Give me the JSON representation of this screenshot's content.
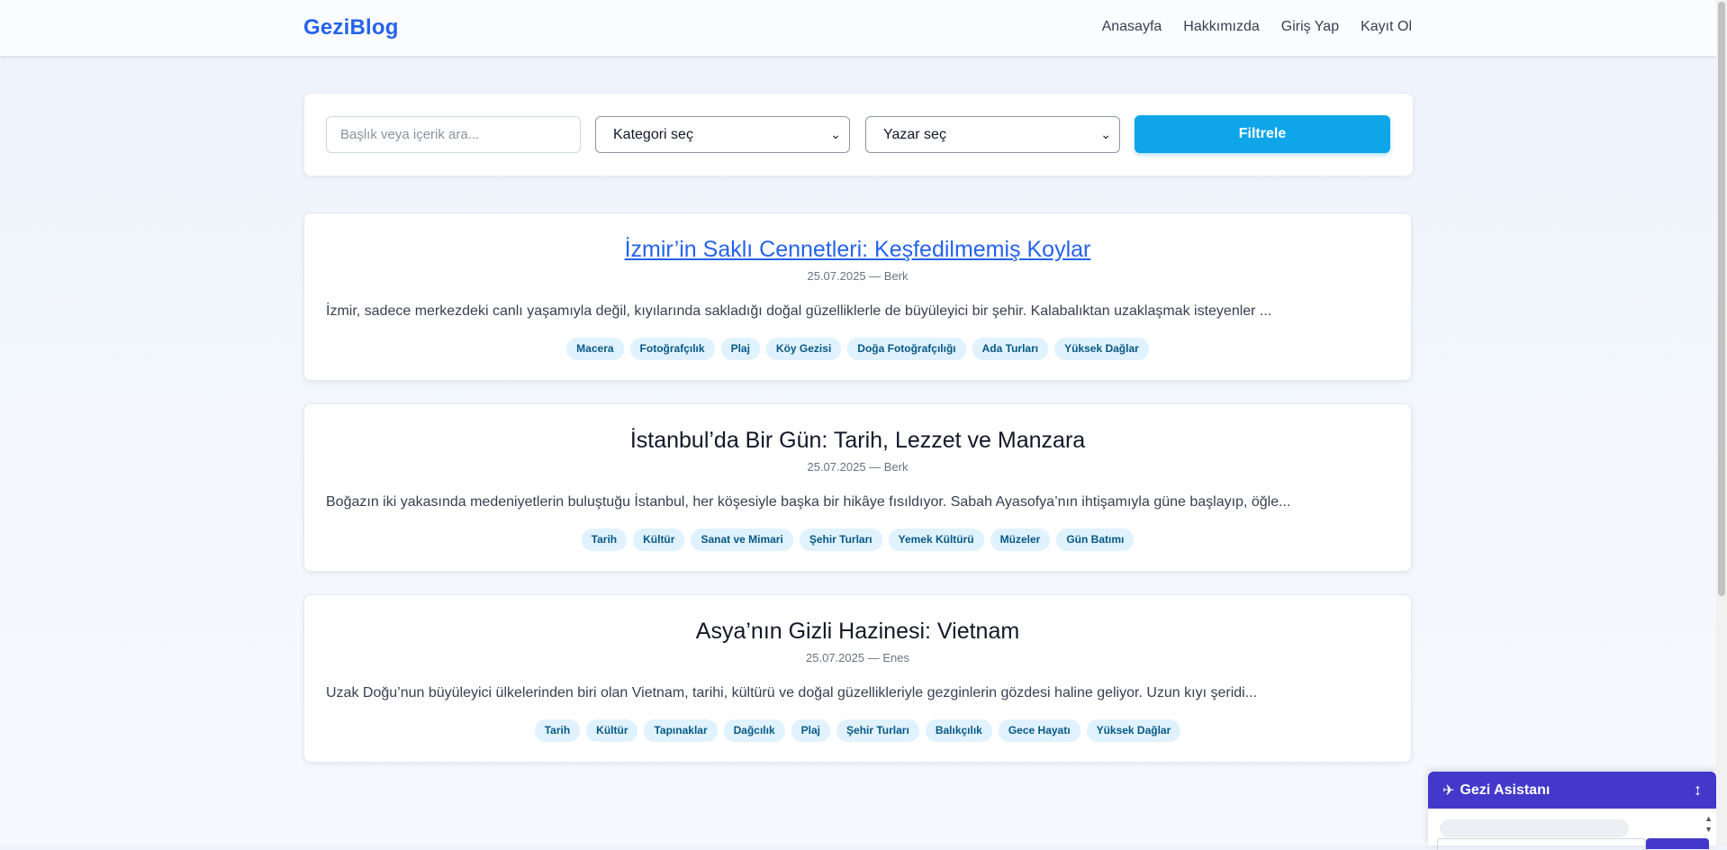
{
  "header": {
    "brand": "GeziBlog",
    "nav": [
      "Anasayfa",
      "Hakkımızda",
      "Giriş Yap",
      "Kayıt Ol"
    ]
  },
  "filters": {
    "search_placeholder": "Başlık veya içerik ara...",
    "category_selected": "Kategori seç",
    "author_selected": "Yazar seç",
    "filter_button": "Filtrele"
  },
  "posts": [
    {
      "title": "İzmir’in Saklı Cennetleri: Keşfedilmemiş Koylar",
      "meta": "25.07.2025 — Berk",
      "excerpt": "İzmir, sadece merkezdeki canlı yaşamıyla değil, kıyılarında sakladığı doğal güzelliklerle de büyüleyici bir şehir. Kalabalıktan uzaklaşmak isteyenler ...",
      "tags": [
        "Macera",
        "Fotoğrafçılık",
        "Plaj",
        "Köy Gezisi",
        "Doğa Fotoğrafçılığı",
        "Ada Turları",
        "Yüksek Dağlar"
      ]
    },
    {
      "title": "İstanbul’da Bir Gün: Tarih, Lezzet ve Manzara",
      "meta": "25.07.2025 — Berk",
      "excerpt": "Boğazın iki yakasında medeniyetlerin buluştuğu İstanbul, her köşesiyle başka bir hikâye fısıldıyor. Sabah Ayasofya’nın ihtişamıyla güne başlayıp, öğle...",
      "tags": [
        "Tarih",
        "Kültür",
        "Sanat ve Mimari",
        "Şehir Turları",
        "Yemek Kültürü",
        "Müzeler",
        "Gün Batımı"
      ]
    },
    {
      "title": "Asya’nın Gizli Hazinesi: Vietnam",
      "meta": "25.07.2025 — Enes",
      "excerpt": "Uzak Doğu’nun büyüleyici ülkelerinden biri olan Vietnam, tarihi, kültürü ve doğal güzellikleriyle gezginlerin gözdesi haline geliyor. Uzun kıyı şeridi...",
      "tags": [
        "Tarih",
        "Kültür",
        "Tapınaklar",
        "Dağcılık",
        "Plaj",
        "Şehir Turları",
        "Balıkçılık",
        "Gece Hayatı",
        "Yüksek Dağlar"
      ]
    }
  ],
  "chat": {
    "title": "Gezi Asistanı",
    "icon": "airplane-icon",
    "toggle_icon": "↕"
  },
  "colors": {
    "brand": "#2563eb",
    "filter_button": "#0ea5e9",
    "tag_bg": "#e0f2fe",
    "tag_text": "#075985",
    "chat_header": "#4338ca"
  }
}
